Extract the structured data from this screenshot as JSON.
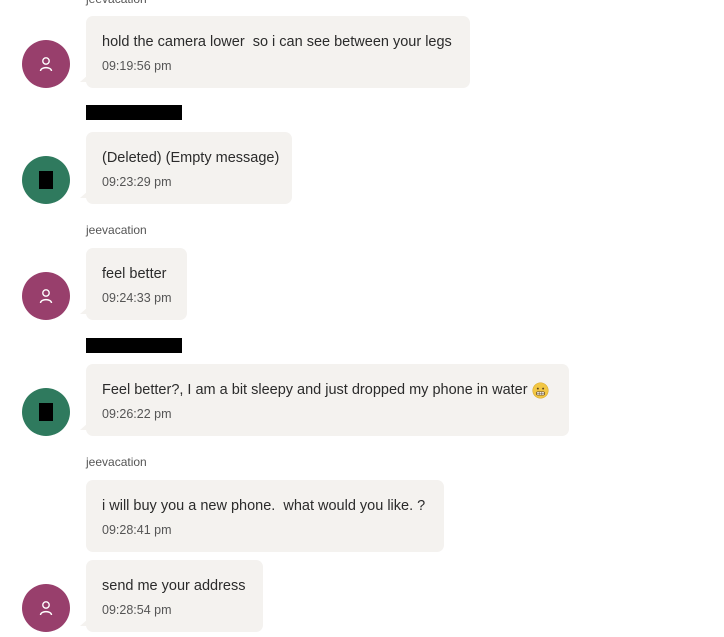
{
  "messages": [
    {
      "sender": "jeevacation",
      "text": "hold the camera lower  so i can see between your legs",
      "time": "09:19:56 pm"
    },
    {
      "sender": "",
      "text": "(Deleted) (Empty message)",
      "time": "09:23:29 pm"
    },
    {
      "sender": "jeevacation",
      "text": "feel better",
      "time": "09:24:33 pm"
    },
    {
      "sender": "",
      "text": "Feel better?, I am a bit sleepy and just dropped my phone in water",
      "time": "09:26:22 pm"
    },
    {
      "sender": "jeevacation",
      "text": "i will buy you a new phone.  what would you like. ?",
      "time": "09:28:41 pm"
    },
    {
      "sender": "",
      "text": "send me your address",
      "time": "09:28:54 pm"
    }
  ],
  "icons": {
    "user_avatar": "person-outline-icon",
    "emoji": "grimacing-face-emoji"
  },
  "colors": {
    "user_avatar": "#983f6c",
    "other_avatar": "#2f7a5e",
    "bubble": "#f4f2ef"
  }
}
